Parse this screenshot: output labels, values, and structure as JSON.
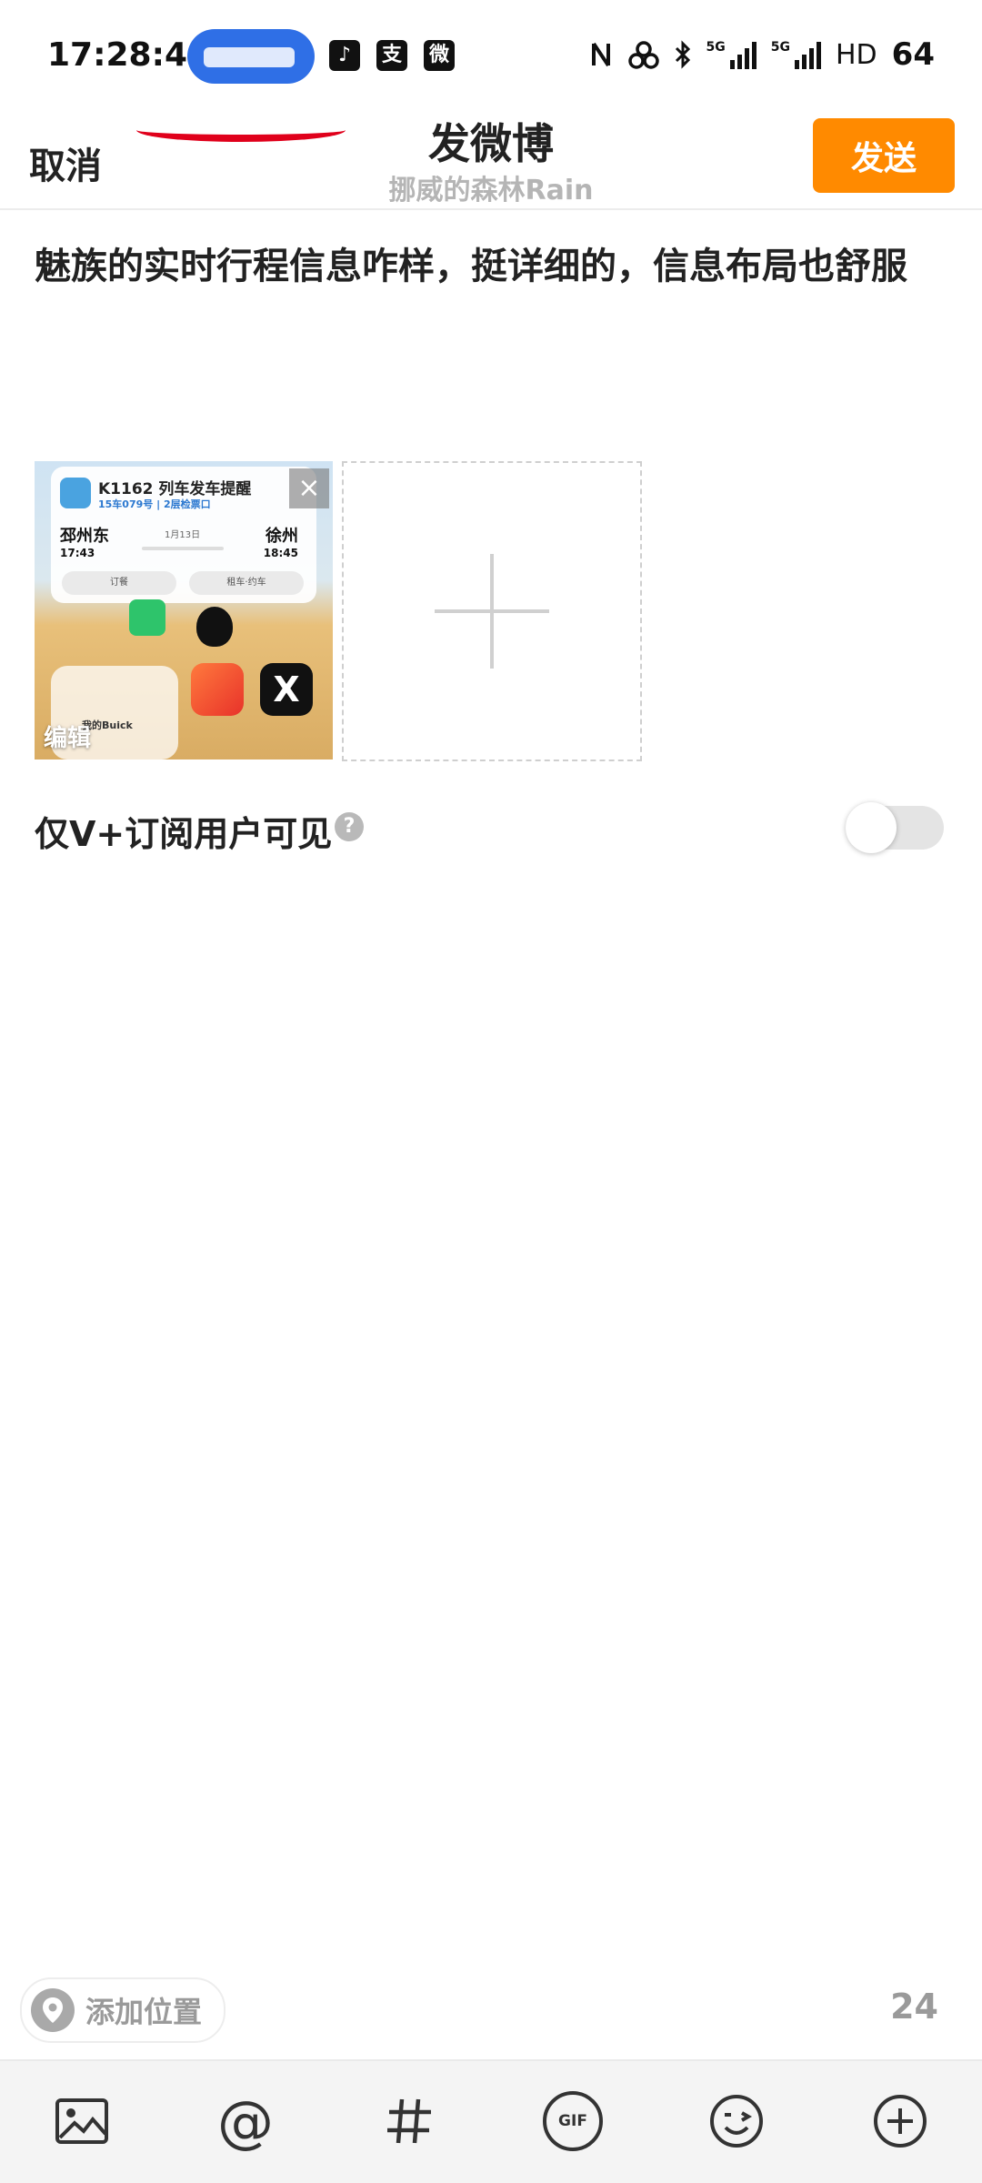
{
  "status_bar": {
    "time": "17:28:41",
    "apps": [
      "tiktok-icon",
      "alipay-icon",
      "weibo-icon"
    ],
    "app_glyphs": [
      "♪",
      "支",
      "微"
    ],
    "network_5g_1": "5G",
    "network_5g_2": "5G",
    "hd_label": "HD",
    "battery": "64"
  },
  "header": {
    "cancel_label": "取消",
    "title": "发微博",
    "subtitle": "挪威的森林Rain",
    "send_label": "发送",
    "send_color": "#ff8a00"
  },
  "post": {
    "text": "魅族的实时行程信息咋样，挺详细的，信息布局也舒服"
  },
  "thumbnail": {
    "edit_label": "编辑",
    "train_title": "K1162 列车发车提醒",
    "train_sub": "15车079号 | 2层检票口",
    "from_station": "邳州东",
    "from_time": "17:43",
    "to_station": "徐州",
    "to_time": "18:45",
    "date": "1月13日",
    "button_1": "订餐",
    "button_2": "租车·约车",
    "widget_text": "我的Buick",
    "close_glyph": "×"
  },
  "vip": {
    "label": "仅V+订阅用户可见",
    "help_glyph": "?",
    "enabled": false
  },
  "location": {
    "label": "添加位置"
  },
  "char_counter": "24",
  "toolbar": {
    "items": [
      "image-icon",
      "mention-icon",
      "hashtag-icon",
      "gif-icon",
      "emoji-icon",
      "more-plus-icon"
    ],
    "mention_glyph": "@",
    "gif_label": "GIF"
  }
}
